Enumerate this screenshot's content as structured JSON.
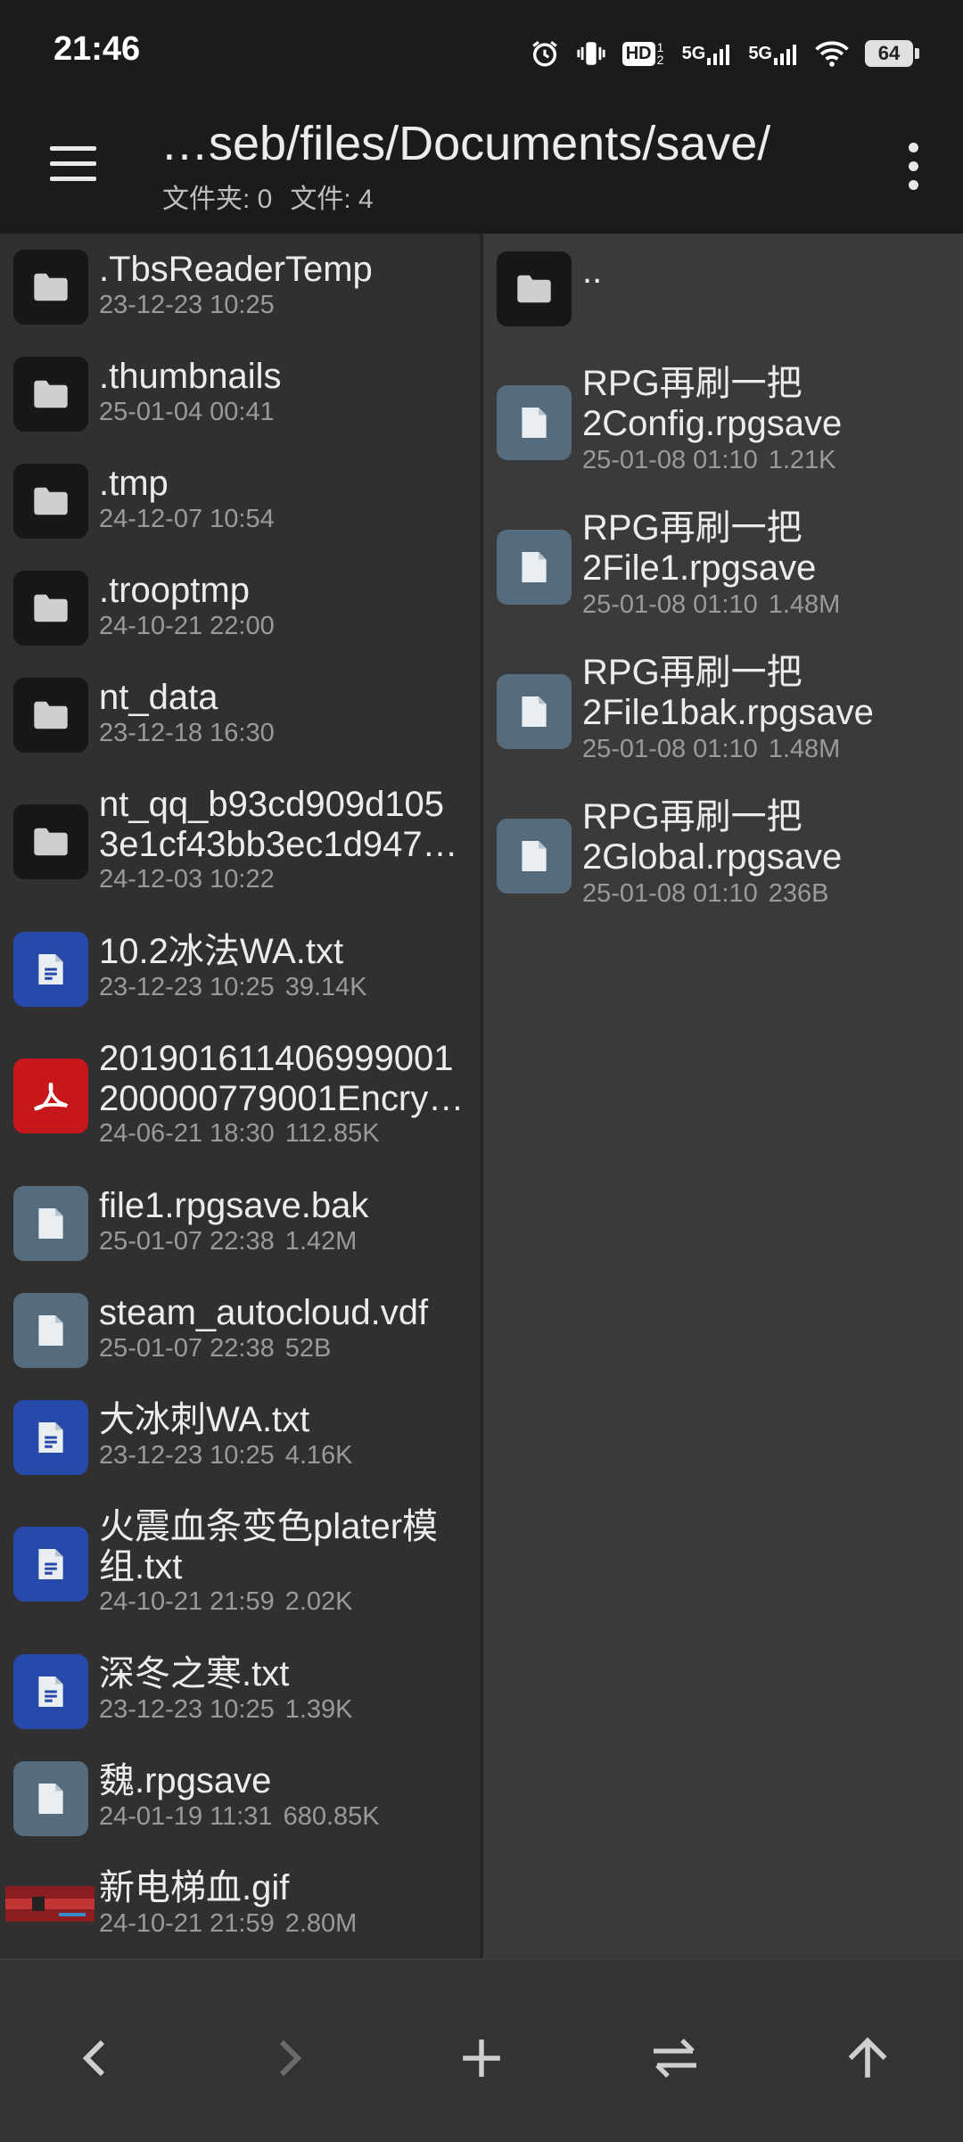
{
  "status": {
    "time": "21:46",
    "hd_label": "HD",
    "hd_sub": "1 2",
    "net1": "5G",
    "net2": "5G",
    "battery": "64"
  },
  "toolbar": {
    "path": "…seb/files/Documents/save/",
    "folders": "文件夹: 0",
    "files": "文件: 4"
  },
  "left_pane": [
    {
      "name": ".TbsReaderTemp",
      "date": "23-12-23 10:25",
      "size": "",
      "type": "folder"
    },
    {
      "name": ".thumbnails",
      "date": "25-01-04 00:41",
      "size": "",
      "type": "folder"
    },
    {
      "name": ".tmp",
      "date": "24-12-07 10:54",
      "size": "",
      "type": "folder"
    },
    {
      "name": ".trooptmp",
      "date": "24-10-21 22:00",
      "size": "",
      "type": "folder"
    },
    {
      "name": "nt_data",
      "date": "23-12-18 16:30",
      "size": "",
      "type": "folder"
    },
    {
      "name": "nt_qq_b93cd909d105",
      "name2": "3e1cf43bb3ec1d947…",
      "date": "24-12-03 10:22",
      "size": "",
      "type": "folder"
    },
    {
      "name": "10.2冰法WA.txt",
      "date": "23-12-23 10:25",
      "size": "39.14K",
      "type": "text"
    },
    {
      "name": "201901611406999001",
      "name2": "200000779001Encry…",
      "date": "24-06-21 18:30",
      "size": "112.85K",
      "type": "pdf"
    },
    {
      "name": "file1.rpgsave.bak",
      "date": "25-01-07 22:38",
      "size": "1.42M",
      "type": "file"
    },
    {
      "name": "steam_autocloud.vdf",
      "date": "25-01-07 22:38",
      "size": "52B",
      "type": "file"
    },
    {
      "name": "大冰刺WA.txt",
      "date": "23-12-23 10:25",
      "size": "4.16K",
      "type": "text"
    },
    {
      "name": "火震血条变色plater模",
      "name2": "组.txt",
      "date": "24-10-21 21:59",
      "size": "2.02K",
      "type": "text"
    },
    {
      "name": "深冬之寒.txt",
      "date": "23-12-23 10:25",
      "size": "1.39K",
      "type": "text"
    },
    {
      "name": "魏.rpgsave",
      "date": "24-01-19 11:31",
      "size": "680.85K",
      "type": "file"
    },
    {
      "name": "新电梯血.gif",
      "date": "24-10-21 21:59",
      "size": "2.80M",
      "type": "image"
    }
  ],
  "right_pane": [
    {
      "name": "..",
      "date": "",
      "size": "",
      "type": "folder"
    },
    {
      "name": "RPG再刷一把",
      "name2": "2Config.rpgsave",
      "date": "25-01-08 01:10",
      "size": "1.21K",
      "type": "file"
    },
    {
      "name": "RPG再刷一把",
      "name2": "2File1.rpgsave",
      "date": "25-01-08 01:10",
      "size": "1.48M",
      "type": "file"
    },
    {
      "name": "RPG再刷一把",
      "name2": "2File1bak.rpgsave",
      "date": "25-01-08 01:10",
      "size": "1.48M",
      "type": "file"
    },
    {
      "name": "RPG再刷一把",
      "name2": "2Global.rpgsave",
      "date": "25-01-08 01:10",
      "size": "236B",
      "type": "file"
    }
  ],
  "icons": {
    "menu": "hamburger-menu-icon",
    "more": "more-vert-icon",
    "back": "chevron-left-icon",
    "forward": "chevron-right-icon",
    "add": "plus-icon",
    "swap": "swap-arrows-icon",
    "up": "arrow-up-icon"
  },
  "colors": {
    "folder": "#171717",
    "file": "#566c7c",
    "text": "#2749a9",
    "pdf": "#c6171a"
  }
}
